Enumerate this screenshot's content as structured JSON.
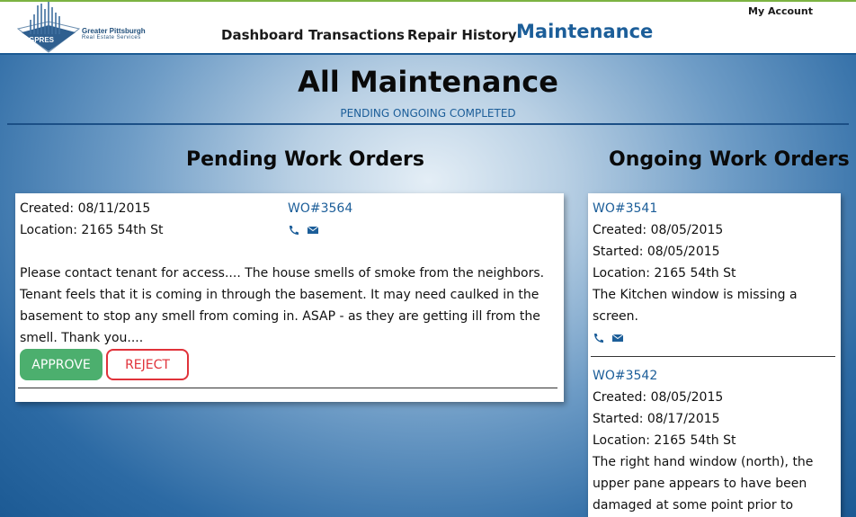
{
  "header": {
    "logo_line1": "Greater Pittsburgh",
    "logo_line2": "Real Estate Services",
    "logo_badge": "GPRES",
    "nav": [
      "Dashboard",
      "Transactions",
      "Repair History",
      "Maintenance"
    ],
    "active_nav": "Maintenance",
    "my_account": "My Account"
  },
  "page": {
    "title": "All Maintenance",
    "filters": [
      "PENDING",
      "ONGOING",
      "COMPLETED"
    ]
  },
  "pending": {
    "heading": "Pending Work Orders",
    "orders": [
      {
        "created": "Created: 08/11/2015",
        "location": "Location: 2165 54th St",
        "wo": "WO#3564",
        "description": "Please contact tenant for access.... The house smells of smoke from the neighbors. Tenant feels that it is coming in through the basement. It may need caulked in the basement to stop any smell from coming in. ASAP - as they are getting ill from the smell. Thank you....",
        "approve_label": "APPROVE",
        "reject_label": "REJECT"
      }
    ]
  },
  "ongoing": {
    "heading": "Ongoing Work Orders",
    "orders": [
      {
        "wo": "WO#3541",
        "created": "Created: 08/05/2015",
        "started": "Started: 08/05/2015",
        "location": "Location: 2165 54th St",
        "description": "The Kitchen window is missing a screen."
      },
      {
        "wo": "WO#3542",
        "created": "Created: 08/05/2015",
        "started": "Started: 08/17/2015",
        "location": "Location: 2165 54th St",
        "description": "The right hand window (north), the upper pane appears to have been damaged at some point prior to move"
      }
    ]
  },
  "colors": {
    "accent": "#1c5e99",
    "approve": "#4caf6e",
    "reject": "#e0323a",
    "header_top_border": "#7cb342"
  },
  "icons": [
    "phone-icon",
    "mail-icon"
  ]
}
